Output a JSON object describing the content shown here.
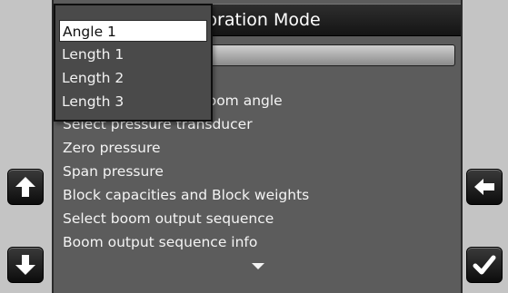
{
  "window": {
    "title": "Calibration Mode",
    "title_visible": "bration Mode"
  },
  "dropdown": {
    "items": [
      "Angle 1",
      "Length 1",
      "Length 2",
      "Length 3"
    ],
    "selected": "Angle 1"
  },
  "menu": {
    "items": [
      "of boom angle",
      "Select pressure transducer",
      "Zero pressure",
      "Span pressure",
      "Block capacities and Block weights",
      "Select boom output sequence",
      "Boom output sequence info"
    ]
  },
  "buttons": {
    "up": "up-arrow-icon",
    "down": "down-arrow-icon",
    "back": "back-arrow-icon",
    "confirm": "checkmark-icon"
  },
  "colors": {
    "screen_bg": "#5c5c5c",
    "title_bg": "#1e1e1e",
    "text": "#f4f4f4"
  }
}
